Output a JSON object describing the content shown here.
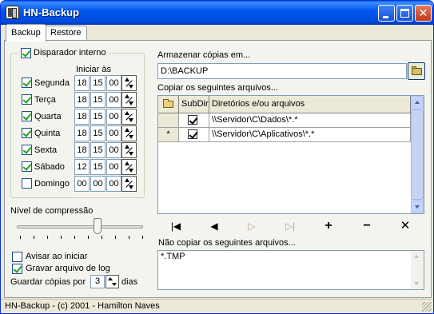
{
  "window": {
    "title": "HN-Backup"
  },
  "tabs": [
    {
      "label": "Backup"
    },
    {
      "label": "Restore"
    }
  ],
  "trigger": {
    "label": "Disparador interno",
    "checked": true,
    "start_at_label": "Iniciar às",
    "days": [
      {
        "name": "Segunda",
        "checked": true,
        "h": "18",
        "m": "15",
        "s": "00"
      },
      {
        "name": "Terça",
        "checked": true,
        "h": "18",
        "m": "15",
        "s": "00"
      },
      {
        "name": "Quarta",
        "checked": true,
        "h": "18",
        "m": "15",
        "s": "00"
      },
      {
        "name": "Quinta",
        "checked": true,
        "h": "18",
        "m": "15",
        "s": "00"
      },
      {
        "name": "Sexta",
        "checked": true,
        "h": "18",
        "m": "15",
        "s": "00"
      },
      {
        "name": "Sábado",
        "checked": true,
        "h": "12",
        "m": "15",
        "s": "00"
      },
      {
        "name": "Domingo",
        "checked": false,
        "h": "00",
        "m": "00",
        "s": "00"
      }
    ]
  },
  "compression": {
    "label": "Nível de compressão",
    "level_fraction": 0.68
  },
  "options": {
    "notify_label": "Avisar ao iniciar",
    "notify_checked": false,
    "log_label": "Gravar arquivo de log",
    "log_checked": true,
    "keep_label": "Guardar cópias por",
    "keep_value": "3",
    "days_label": "dias"
  },
  "storage": {
    "label": "Armazenar cópias em...",
    "path": "D:\\BACKUP"
  },
  "copy": {
    "label": "Copiar os seguintes arquivos...",
    "headers": {
      "subdirs": "SubDirs",
      "dirs": "Diretórios e/ou arquivos"
    },
    "rows": [
      {
        "indicator": "",
        "subdirs": true,
        "path": "\\\\Servidor\\C\\Dados\\*.*"
      },
      {
        "indicator": "*",
        "subdirs": true,
        "path": "\\\\Servidor\\C\\Aplicativos\\*.*"
      }
    ]
  },
  "navigator": {
    "first": "|◀",
    "prev": "◀",
    "next": "▷",
    "last": "▷|",
    "add": "+",
    "delete": "−",
    "cancel": "✕"
  },
  "exclude": {
    "label": "Não copiar os seguintes arquivos...",
    "value": "*.TMP"
  },
  "status": "HN-Backup - (c) 2001 - Hamilton Naves"
}
